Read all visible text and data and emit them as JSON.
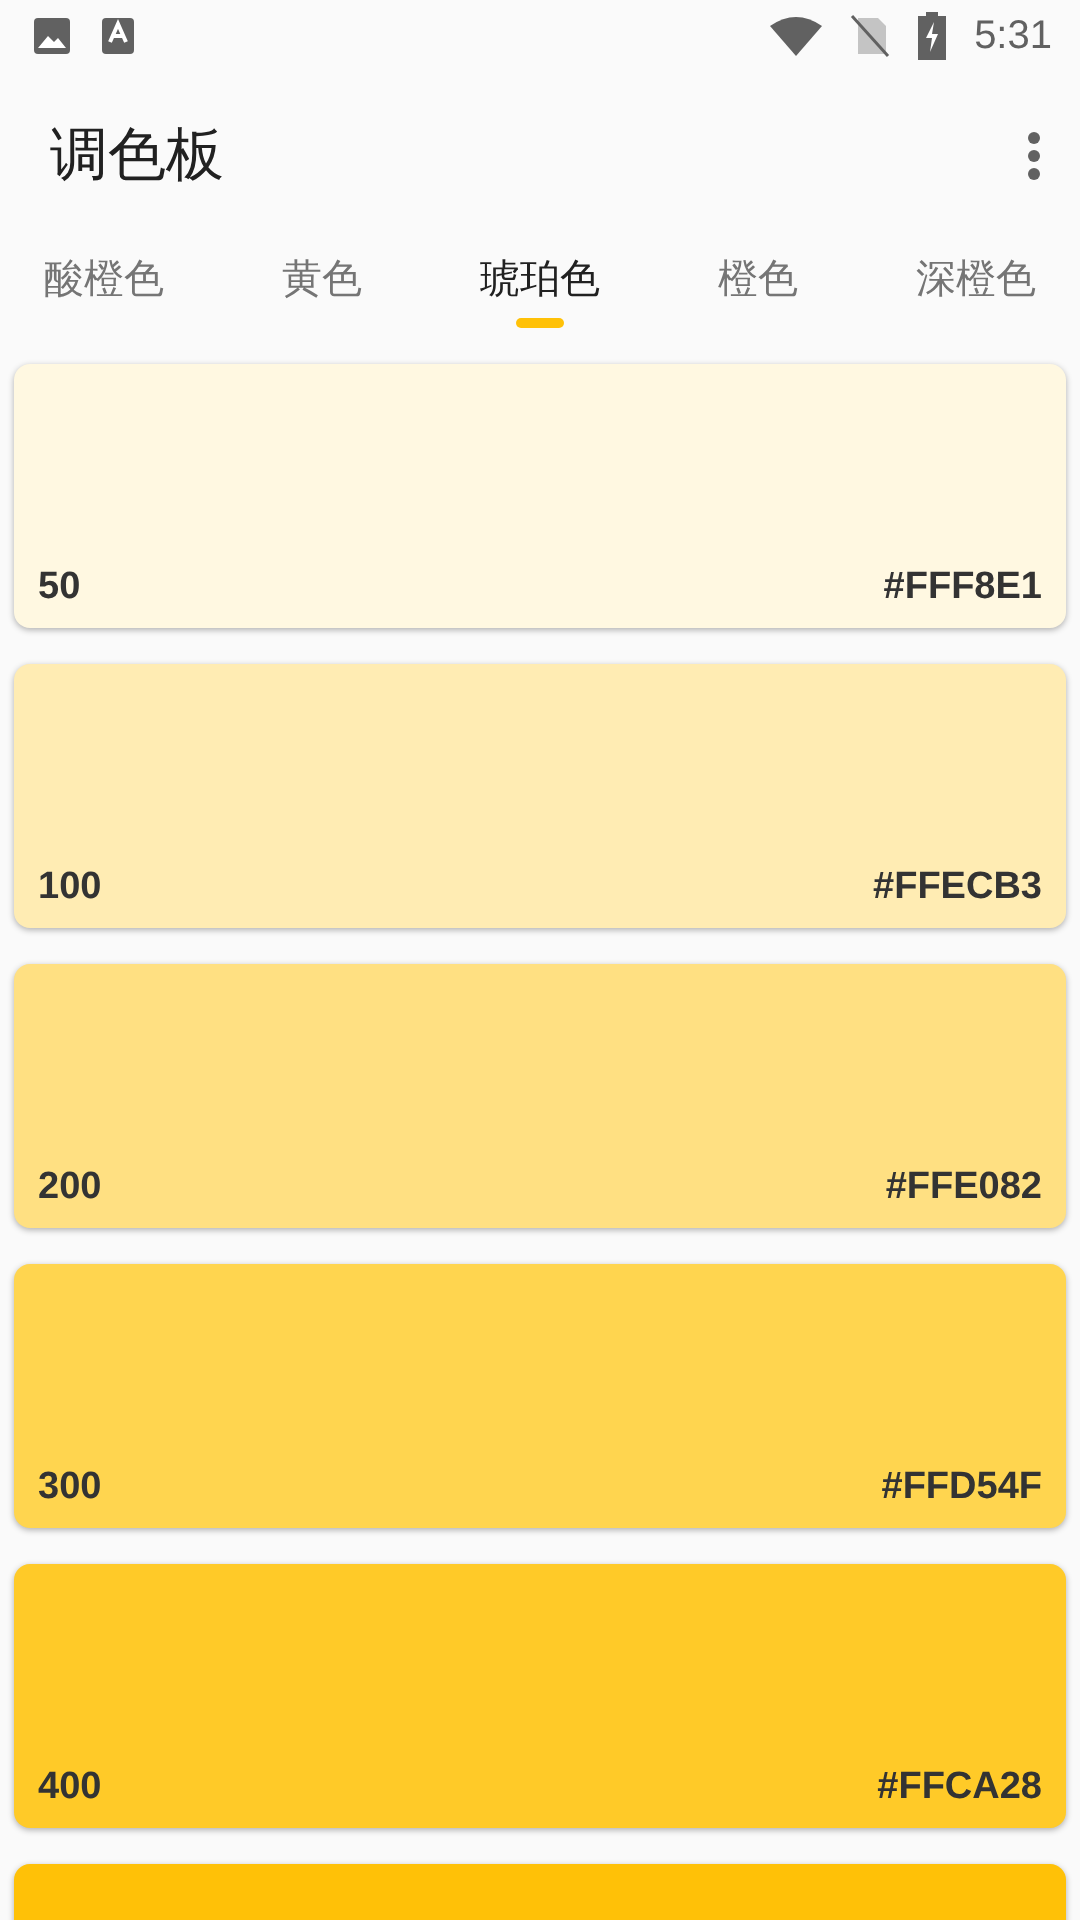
{
  "status_bar": {
    "time": "5:31"
  },
  "app_bar": {
    "title": "调色板"
  },
  "tabs": [
    {
      "label": "酸橙色",
      "selected": false
    },
    {
      "label": "黄色",
      "selected": false
    },
    {
      "label": "琥珀色",
      "selected": true
    },
    {
      "label": "橙色",
      "selected": false
    },
    {
      "label": "深橙色",
      "selected": false
    }
  ],
  "swatches": [
    {
      "shade": "50",
      "hex": "#FFF8E1",
      "color": "#fff8e1"
    },
    {
      "shade": "100",
      "hex": "#FFECB3",
      "color": "#ffecb3"
    },
    {
      "shade": "200",
      "hex": "#FFE082",
      "color": "#ffe082"
    },
    {
      "shade": "300",
      "hex": "#FFD54F",
      "color": "#ffd54f"
    },
    {
      "shade": "400",
      "hex": "#FFCA28",
      "color": "#ffca28"
    },
    {
      "color": "#ffc107"
    }
  ]
}
